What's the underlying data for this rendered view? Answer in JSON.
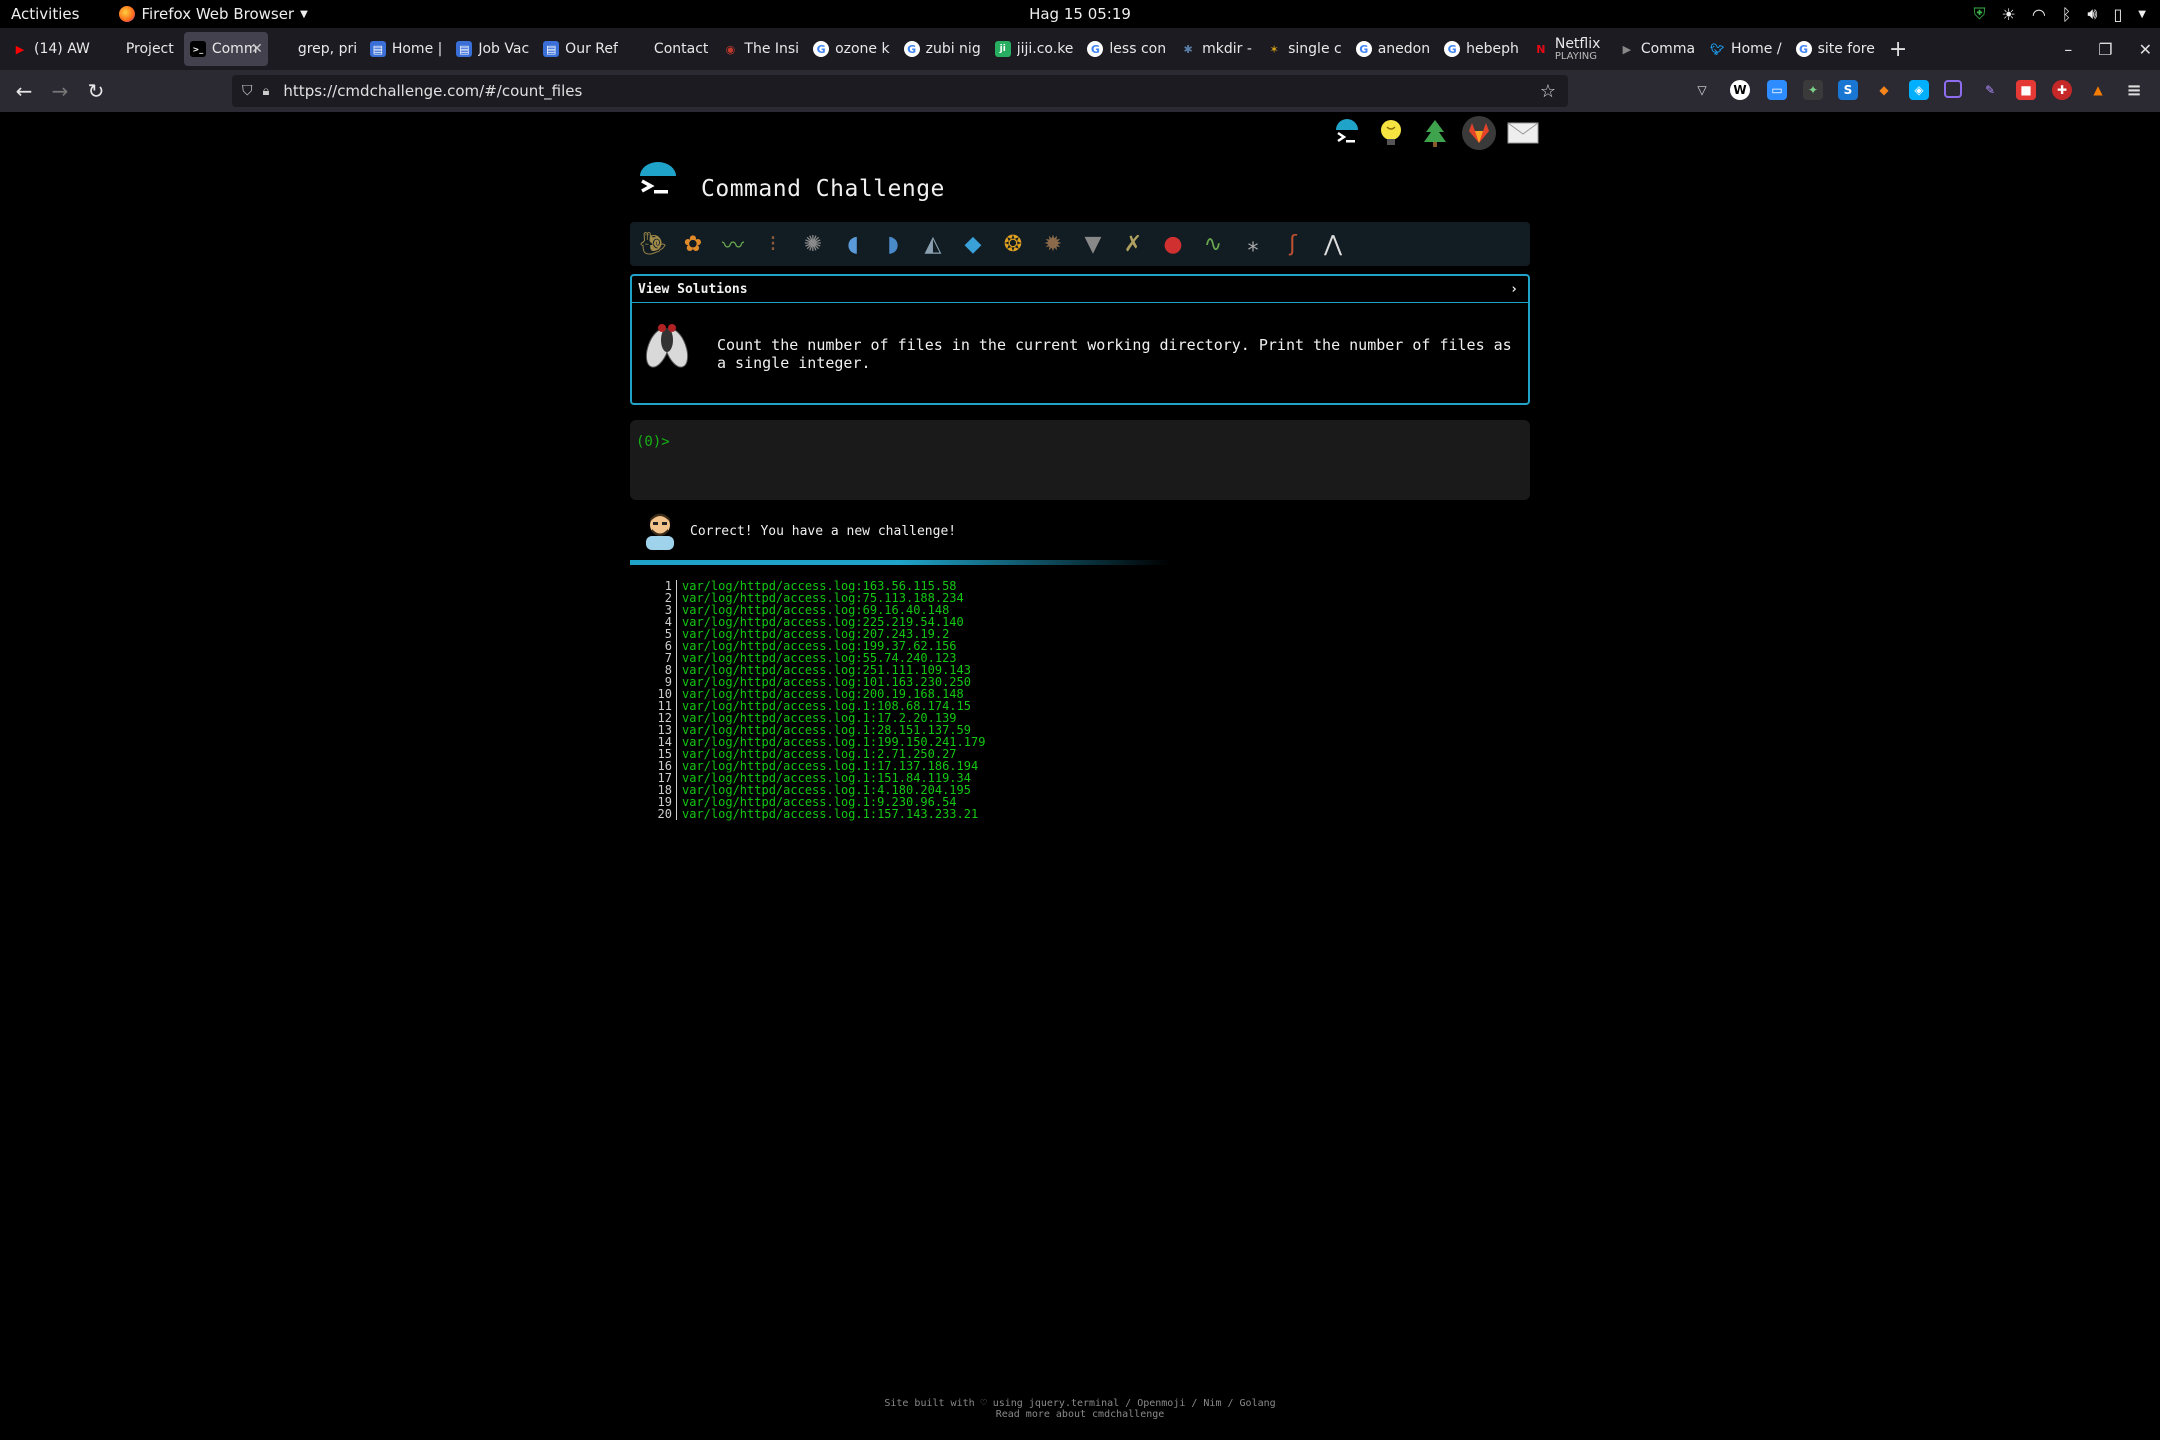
{
  "topbar": {
    "activities": "Activities",
    "app_name": "Firefox Web Browser",
    "clock": "Hag 15  05:19"
  },
  "tabs": [
    {
      "title": "(14) AW",
      "favicon": "youtube-icon",
      "color": "#ff0000"
    },
    {
      "title": "Project",
      "favicon": "blank-icon",
      "color": "#1c1b22"
    },
    {
      "title": "Comm",
      "favicon": "terminal-icon",
      "color": "#000000",
      "active": true
    },
    {
      "title": "grep, print",
      "favicon": "blank-icon",
      "color": "#1c1b22"
    },
    {
      "title": "Home |",
      "favicon": "page-icon",
      "color": "#3a6fd8"
    },
    {
      "title": "Job Vac",
      "favicon": "page-icon",
      "color": "#3a6fd8"
    },
    {
      "title": "Our Ref",
      "favicon": "page-icon",
      "color": "#3a6fd8"
    },
    {
      "title": "Contact",
      "favicon": "blank-icon",
      "color": "#1c1b22"
    },
    {
      "title": "The Insi",
      "favicon": "site-icon",
      "color": "#c0392b"
    },
    {
      "title": "ozone k",
      "favicon": "google-icon",
      "color": "#ffffff"
    },
    {
      "title": "zubi nig",
      "favicon": "google-icon",
      "color": "#ffffff"
    },
    {
      "title": "jiji.co.ke",
      "favicon": "jiji-icon",
      "color": "#27ae60"
    },
    {
      "title": "less con",
      "favicon": "google-icon",
      "color": "#ffffff"
    },
    {
      "title": "mkdir -",
      "favicon": "bug-icon",
      "color": "#5a7fa8"
    },
    {
      "title": "single c",
      "favicon": "spark-icon",
      "color": "#d4a017"
    },
    {
      "title": "anedon",
      "favicon": "google-icon",
      "color": "#ffffff"
    },
    {
      "title": "hebeph",
      "favicon": "google-icon",
      "color": "#ffffff"
    },
    {
      "title": "Netflix",
      "subtitle": "PLAYING",
      "favicon": "netflix-icon",
      "color": "#e50914"
    },
    {
      "title": "Comma",
      "favicon": "play-icon",
      "color": "#888888"
    },
    {
      "title": "Home /",
      "favicon": "twitter-icon",
      "color": "#1da1f2"
    },
    {
      "title": "site fore",
      "favicon": "google-icon",
      "color": "#ffffff"
    }
  ],
  "navbar": {
    "url": "https://cmdchallenge.com/#/count_files"
  },
  "page": {
    "site_title": "Command Challenge",
    "panel_header": "View Solutions",
    "panel_chevron": "›",
    "challenge_description": "Count the number of files in the current working directory. Print the number of files as a single integer.",
    "prompt": "(0)>",
    "feedback": "Correct! You have a new challenge!",
    "footer_line1": "Site built with ♡ using jquery.terminal / Openmoji / Nim / Golang",
    "footer_line2": "Read more about cmdchallenge"
  },
  "challenge_icons": [
    "snail",
    "butterfly",
    "caterpillar",
    "ant",
    "microbe",
    "whale",
    "dolphin",
    "shark",
    "fish",
    "tropical-fish",
    "hedgehog",
    "wolf",
    "mosquito",
    "ladybug",
    "worm",
    "mosquito-small",
    "scorpion",
    "fly"
  ],
  "output_lines": [
    "var/log/httpd/access.log:163.56.115.58",
    "var/log/httpd/access.log:75.113.188.234",
    "var/log/httpd/access.log:69.16.40.148",
    "var/log/httpd/access.log:225.219.54.140",
    "var/log/httpd/access.log:207.243.19.2",
    "var/log/httpd/access.log:199.37.62.156",
    "var/log/httpd/access.log:55.74.240.123",
    "var/log/httpd/access.log:251.111.109.143",
    "var/log/httpd/access.log:101.163.230.250",
    "var/log/httpd/access.log:200.19.168.148",
    "var/log/httpd/access.log.1:108.68.174.15",
    "var/log/httpd/access.log.1:17.2.20.139",
    "var/log/httpd/access.log.1:28.151.137.59",
    "var/log/httpd/access.log.1:199.150.241.179",
    "var/log/httpd/access.log.1:2.71.250.27",
    "var/log/httpd/access.log.1:17.137.186.194",
    "var/log/httpd/access.log.1:151.84.119.34",
    "var/log/httpd/access.log.1:4.180.204.195",
    "var/log/httpd/access.log.1:9.230.96.54",
    "var/log/httpd/access.log.1:157.143.233.21"
  ],
  "colors": {
    "accent": "#1fa3c9",
    "terminal_green": "#14c814",
    "tab_active": "#42414d"
  }
}
